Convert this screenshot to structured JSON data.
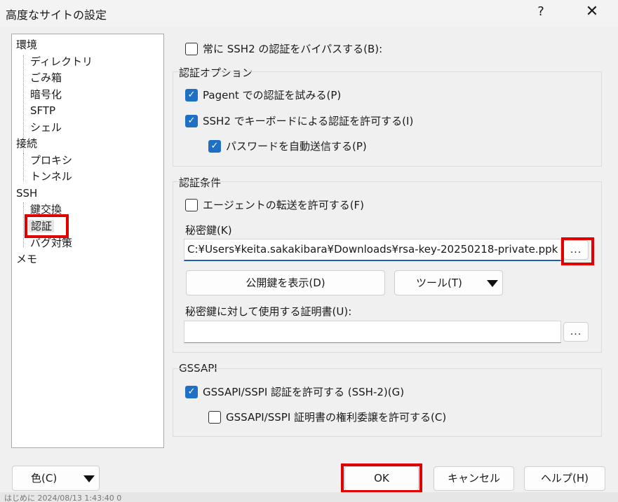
{
  "window": {
    "title": "高度なサイトの設定",
    "help_glyph": "?",
    "close_glyph": "✕"
  },
  "tree": {
    "items": [
      {
        "label": "環境",
        "level": 0
      },
      {
        "label": "ディレクトリ",
        "level": 1
      },
      {
        "label": "ごみ箱",
        "level": 1
      },
      {
        "label": "暗号化",
        "level": 1
      },
      {
        "label": "SFTP",
        "level": 1
      },
      {
        "label": "シェル",
        "level": 1
      },
      {
        "label": "接続",
        "level": 0
      },
      {
        "label": "プロキシ",
        "level": 1
      },
      {
        "label": "トンネル",
        "level": 1
      },
      {
        "label": "SSH",
        "level": 0
      },
      {
        "label": "鍵交換",
        "level": 1
      },
      {
        "label": "認証",
        "level": 1,
        "selected": true
      },
      {
        "label": "バグ対策",
        "level": 1
      },
      {
        "label": "メモ",
        "level": 0
      }
    ]
  },
  "top": {
    "bypass_label": "常に SSH2 の認証をバイパスする(B):",
    "bypass_checked": false
  },
  "auth_options": {
    "heading": "認証オプション",
    "pagent_label": "Pagent での認証を試みる(P)",
    "pagent_checked": true,
    "keyboard_label": "SSH2 でキーボードによる認証を許可する(I)",
    "keyboard_checked": true,
    "autopass_label": "パスワードを自動送信する(P)",
    "autopass_checked": true
  },
  "auth_conditions": {
    "heading": "認証条件",
    "agent_forward_label": "エージェントの転送を許可する(F)",
    "agent_forward_checked": false,
    "private_key_label": "秘密鍵(K)",
    "private_key_value": "C:¥Users¥keita.sakakibara¥Downloads¥rsa-key-20250218-private.ppk",
    "browse_label": "...",
    "show_public_key_label": "公開鍵を表示(D)",
    "tools_label": "ツール(T)",
    "cert_label": "秘密鍵に対して使用する証明書(U):",
    "cert_value": "",
    "cert_browse_label": "..."
  },
  "gssapi": {
    "heading": "GSSAPI",
    "allow_label": "GSSAPI/SSPI 認証を許可する (SSH-2)(G)",
    "allow_checked": true,
    "delegate_label": "GSSAPI/SSPI 証明書の権利委譲を許可する(C)",
    "delegate_checked": false
  },
  "footer": {
    "color_label": "色(C)",
    "ok_label": "OK",
    "cancel_label": "キャンセル",
    "help_label": "ヘルプ(H)",
    "bottom_text": "はじめに            2024/08/13 1:43:40 0"
  },
  "colors": {
    "accent": "#1f6fc5",
    "highlight": "#e00000"
  }
}
